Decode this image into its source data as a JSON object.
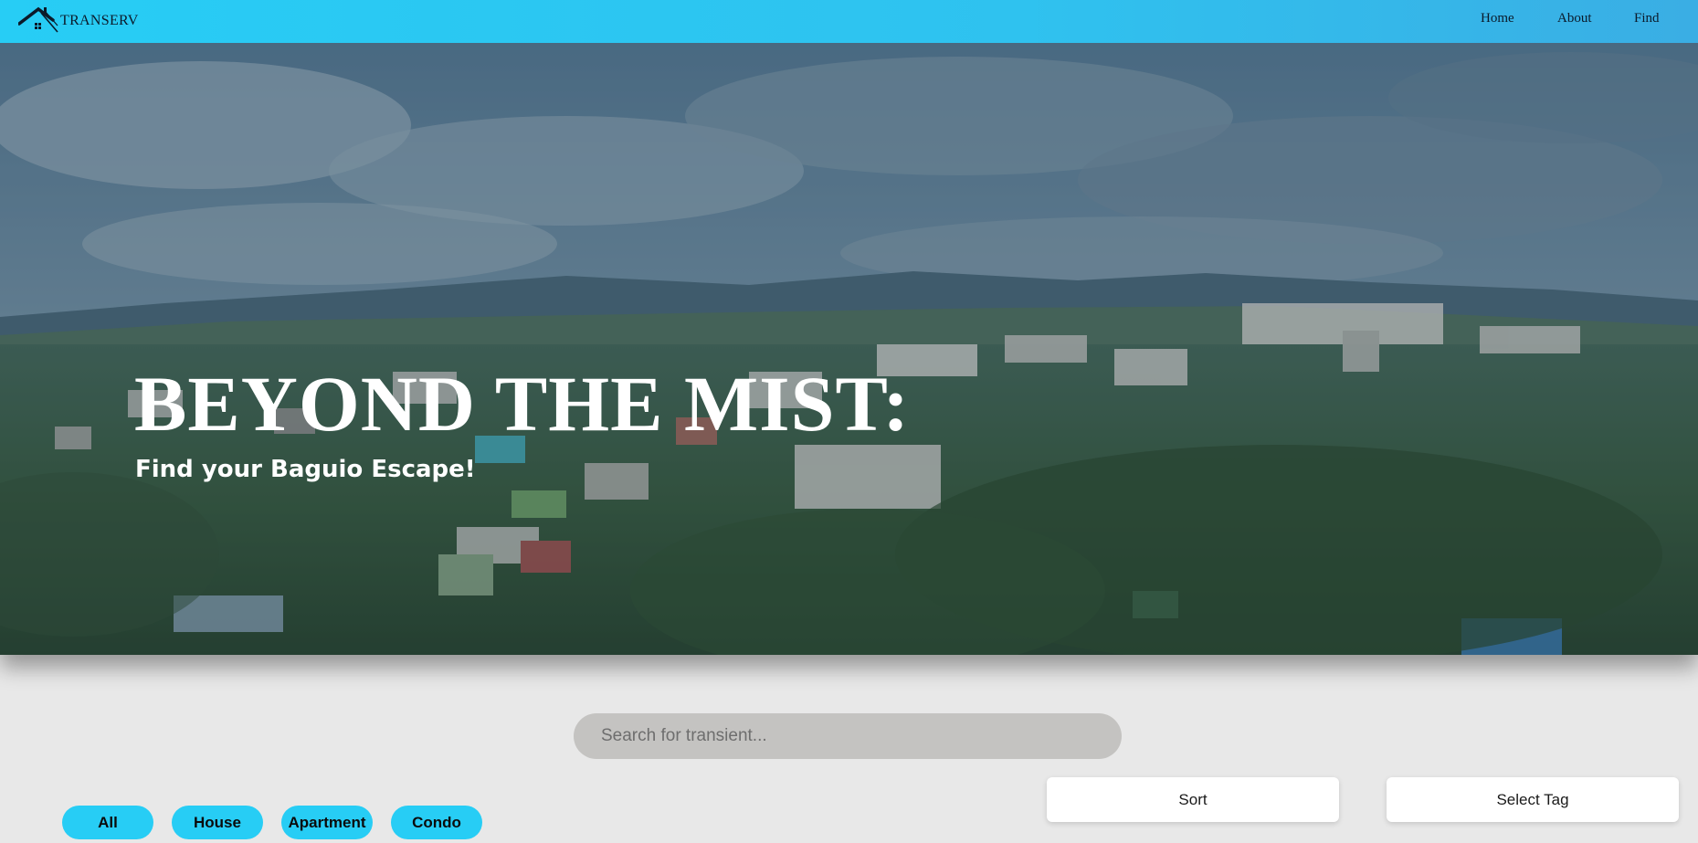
{
  "brand": {
    "name": "TRANSERV",
    "logo_icon": "house-roof-icon"
  },
  "nav": {
    "home": "Home",
    "about": "About",
    "find": "Find"
  },
  "hero": {
    "title": "BEYOND THE MIST:",
    "subtitle": "Find your Baguio Escape!",
    "image": "baguio-city-skyline-photo"
  },
  "search": {
    "placeholder": "Search for transient...",
    "value": ""
  },
  "filters": [
    "All",
    "House",
    "Apartment",
    "Condo"
  ],
  "controls": {
    "sort": "Sort",
    "select_tag": "Select Tag"
  },
  "colors": {
    "accent": "#27cdf5",
    "page_bg": "#e8e8e8",
    "search_bg": "#c4c3c1"
  }
}
